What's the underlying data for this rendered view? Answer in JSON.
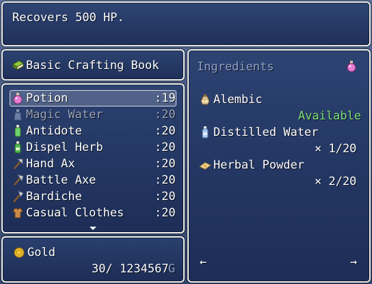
{
  "help": {
    "text": "Recovers 500 HP."
  },
  "book": {
    "title": "Basic Crafting Book",
    "icon": "book-icon"
  },
  "items": [
    {
      "name": "Potion",
      "qty": ":19",
      "icon": "potion-icon",
      "enabled": true,
      "selected": true
    },
    {
      "name": "Magic Water",
      "qty": ":20",
      "icon": "magic-water-icon",
      "enabled": false,
      "selected": false
    },
    {
      "name": "Antidote",
      "qty": ":20",
      "icon": "antidote-icon",
      "enabled": true,
      "selected": false
    },
    {
      "name": "Dispel Herb",
      "qty": ":20",
      "icon": "herb-bottle-icon",
      "enabled": true,
      "selected": false
    },
    {
      "name": "Hand Ax",
      "qty": ":20",
      "icon": "axe-icon",
      "enabled": true,
      "selected": false
    },
    {
      "name": "Battle Axe",
      "qty": ":20",
      "icon": "axe-icon",
      "enabled": true,
      "selected": false
    },
    {
      "name": "Bardiche",
      "qty": ":20",
      "icon": "axe-icon",
      "enabled": true,
      "selected": false
    },
    {
      "name": "Casual Clothes",
      "qty": ":20",
      "icon": "clothes-icon",
      "enabled": true,
      "selected": false
    }
  ],
  "gold": {
    "label": "Gold",
    "amount": "30/ 1234567",
    "unit": "G",
    "icon": "gold-coin-icon"
  },
  "ingredients": {
    "header": "Ingredients",
    "header_icon": "potion-icon",
    "entries": [
      {
        "name": "Alembic",
        "icon": "alembic-icon",
        "status": "Available"
      },
      {
        "name": "Distilled Water",
        "icon": "water-bottle-icon",
        "status": "× 1/20"
      },
      {
        "name": "Herbal Powder",
        "icon": "powder-icon",
        "status": "× 2/20"
      }
    ],
    "prev": "←",
    "next": "→"
  },
  "colors": {
    "window_border": "#f2f2f2",
    "system_text": "#8fa2c8",
    "disabled_text": "#9aa4b8",
    "available_text": "#7ee07a",
    "cursor": "rgba(255,255,255,0.18)"
  }
}
